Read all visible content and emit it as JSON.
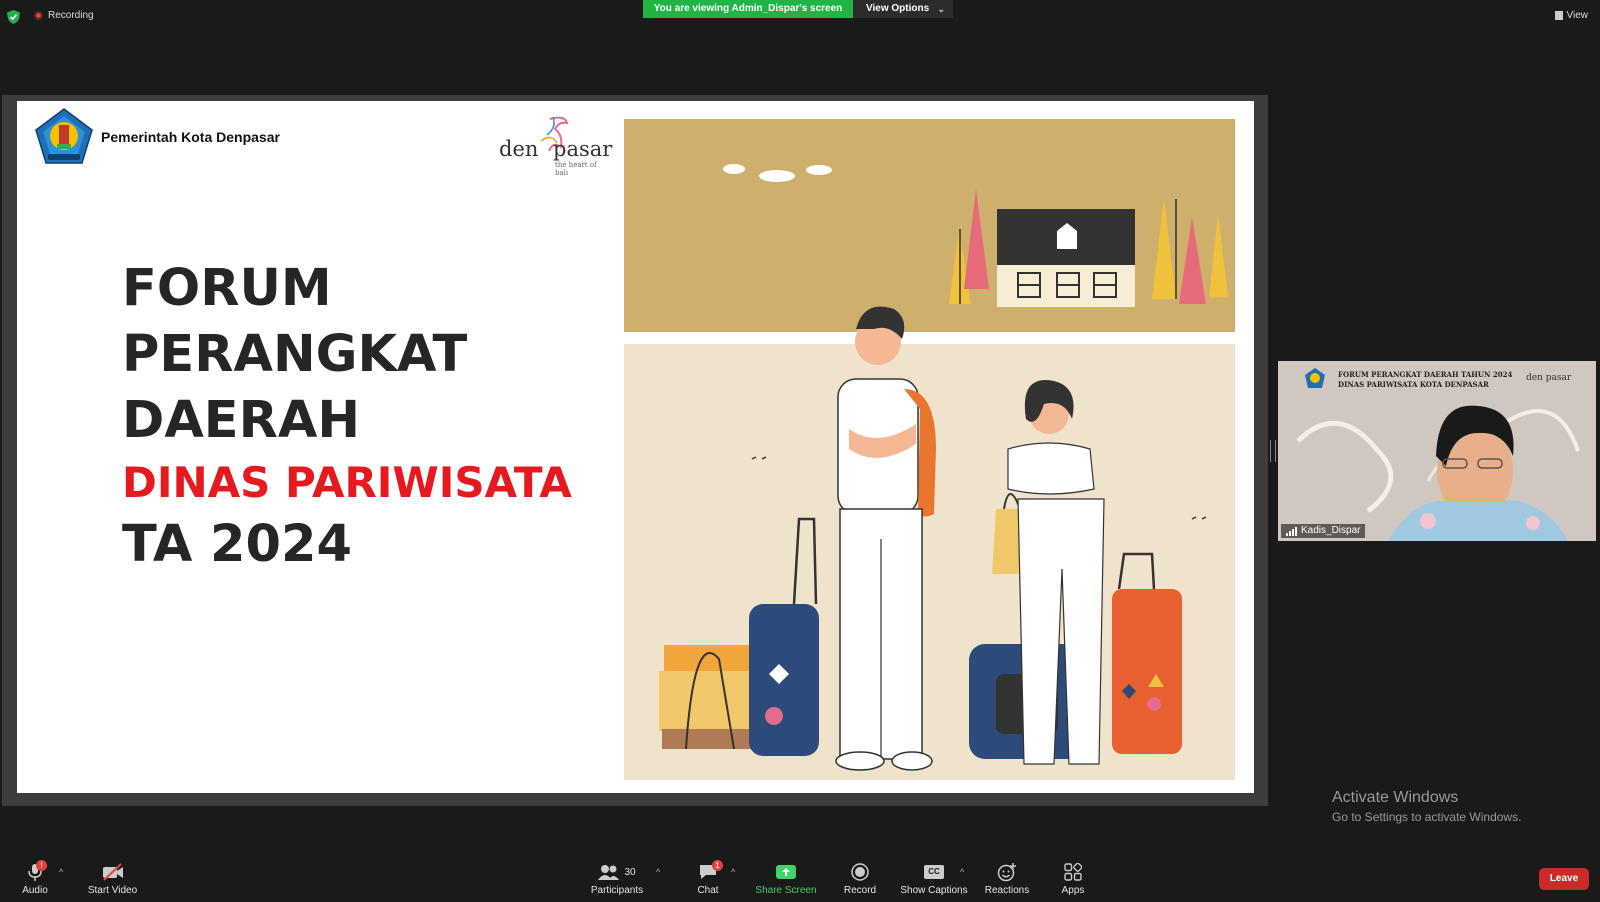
{
  "topbar": {
    "recording_label": "Recording",
    "viewing_banner": "You are viewing Admin_Dispar's screen",
    "view_options_label": "View Options",
    "view_label": "View"
  },
  "slide": {
    "gov_name": "Pemerintah  Kota Denpasar",
    "brand_logo": {
      "den": "den",
      "pasar": "pasar",
      "tagline": "the heart of bali"
    },
    "title_lines": [
      "FORUM",
      "PERANGKAT",
      "DAERAH"
    ],
    "subtitle": "DINAS PARIWISATA",
    "year_line": "TA 2024",
    "accent_color": "#e5191e",
    "illustration": "travelers-with-luggage-and-house"
  },
  "participant_video": {
    "header_line1": "FORUM PERANGKAT DAERAH TAHUN 2024",
    "header_line2": "DINAS PARIWISATA KOTA DENPASAR",
    "logo_text": "den pasar",
    "name": "Kadis_Dispar"
  },
  "watermark": {
    "title": "Activate Windows",
    "subtitle": "Go to Settings to activate Windows."
  },
  "toolbar": {
    "audio_label": "Audio",
    "start_video_label": "Start Video",
    "participants_label": "Participants",
    "participants_count": "30",
    "chat_label": "Chat",
    "chat_badge": "1",
    "share_screen_label": "Share Screen",
    "record_label": "Record",
    "show_captions_label": "Show Captions",
    "captions_icon_text": "CC",
    "reactions_label": "Reactions",
    "apps_label": "Apps",
    "leave_label": "Leave",
    "accent_green": "#43d16b",
    "leave_color": "#cc2a2a"
  }
}
